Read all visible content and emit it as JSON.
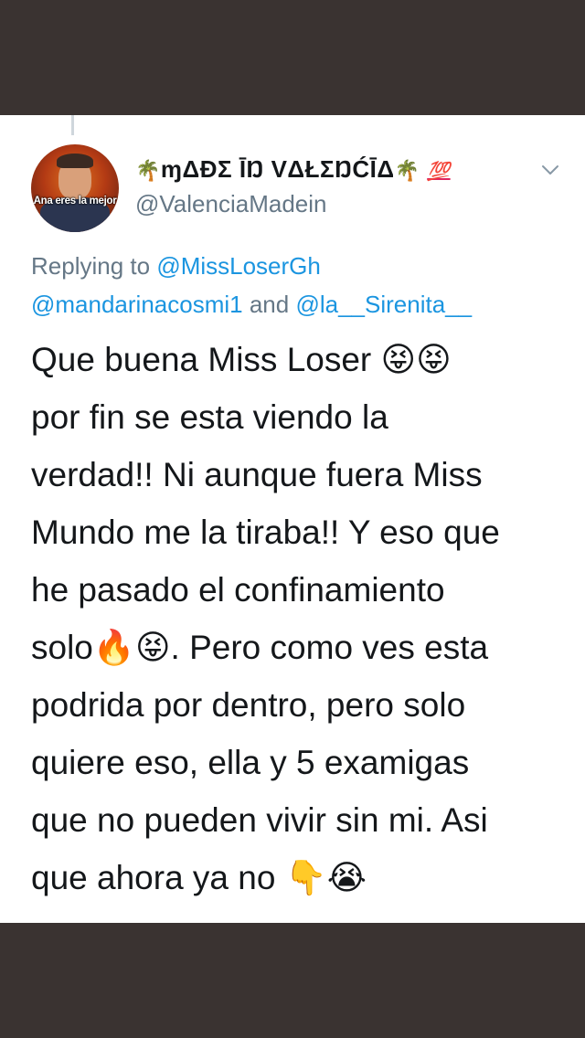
{
  "tweet": {
    "author": {
      "display_name_prefix": "🌴",
      "display_name": "ɱΔĐΣ ĪŊ VΔŁΣŊĆĪΔ",
      "display_name_suffix": "🌴",
      "display_name_badge": "💯",
      "handle": "@ValenciaMadein",
      "avatar_caption": "Ana eres la mejor"
    },
    "replying": {
      "prefix": "Replying to",
      "mention_1": "@MissLoserGh",
      "mention_2": "@mandarinacosmi1",
      "conjunction": "and",
      "mention_3": "@la__Sirenita__"
    },
    "text": {
      "line_1": "Que buena Miss Loser",
      "emoji_1": "😝😝",
      "line_2": "por fin se esta viendo la",
      "line_3": "verdad!! Ni aunque fuera Miss",
      "line_4": "Mundo me la tiraba!! Y eso que",
      "line_5": "he pasado el confinamiento",
      "line_6_start": "solo",
      "emoji_2": "🔥😝",
      "line_6_end": ". Pero como ves esta",
      "line_7": "podrida por dentro, pero solo",
      "line_8": "quiere eso, ella y 5 examigas",
      "line_9": "que no pueden vivir sin mi. Asi",
      "line_10": "que ahora ya no",
      "emoji_3": "👇😭"
    },
    "icons": {
      "menu": "chevron-down-icon"
    }
  }
}
